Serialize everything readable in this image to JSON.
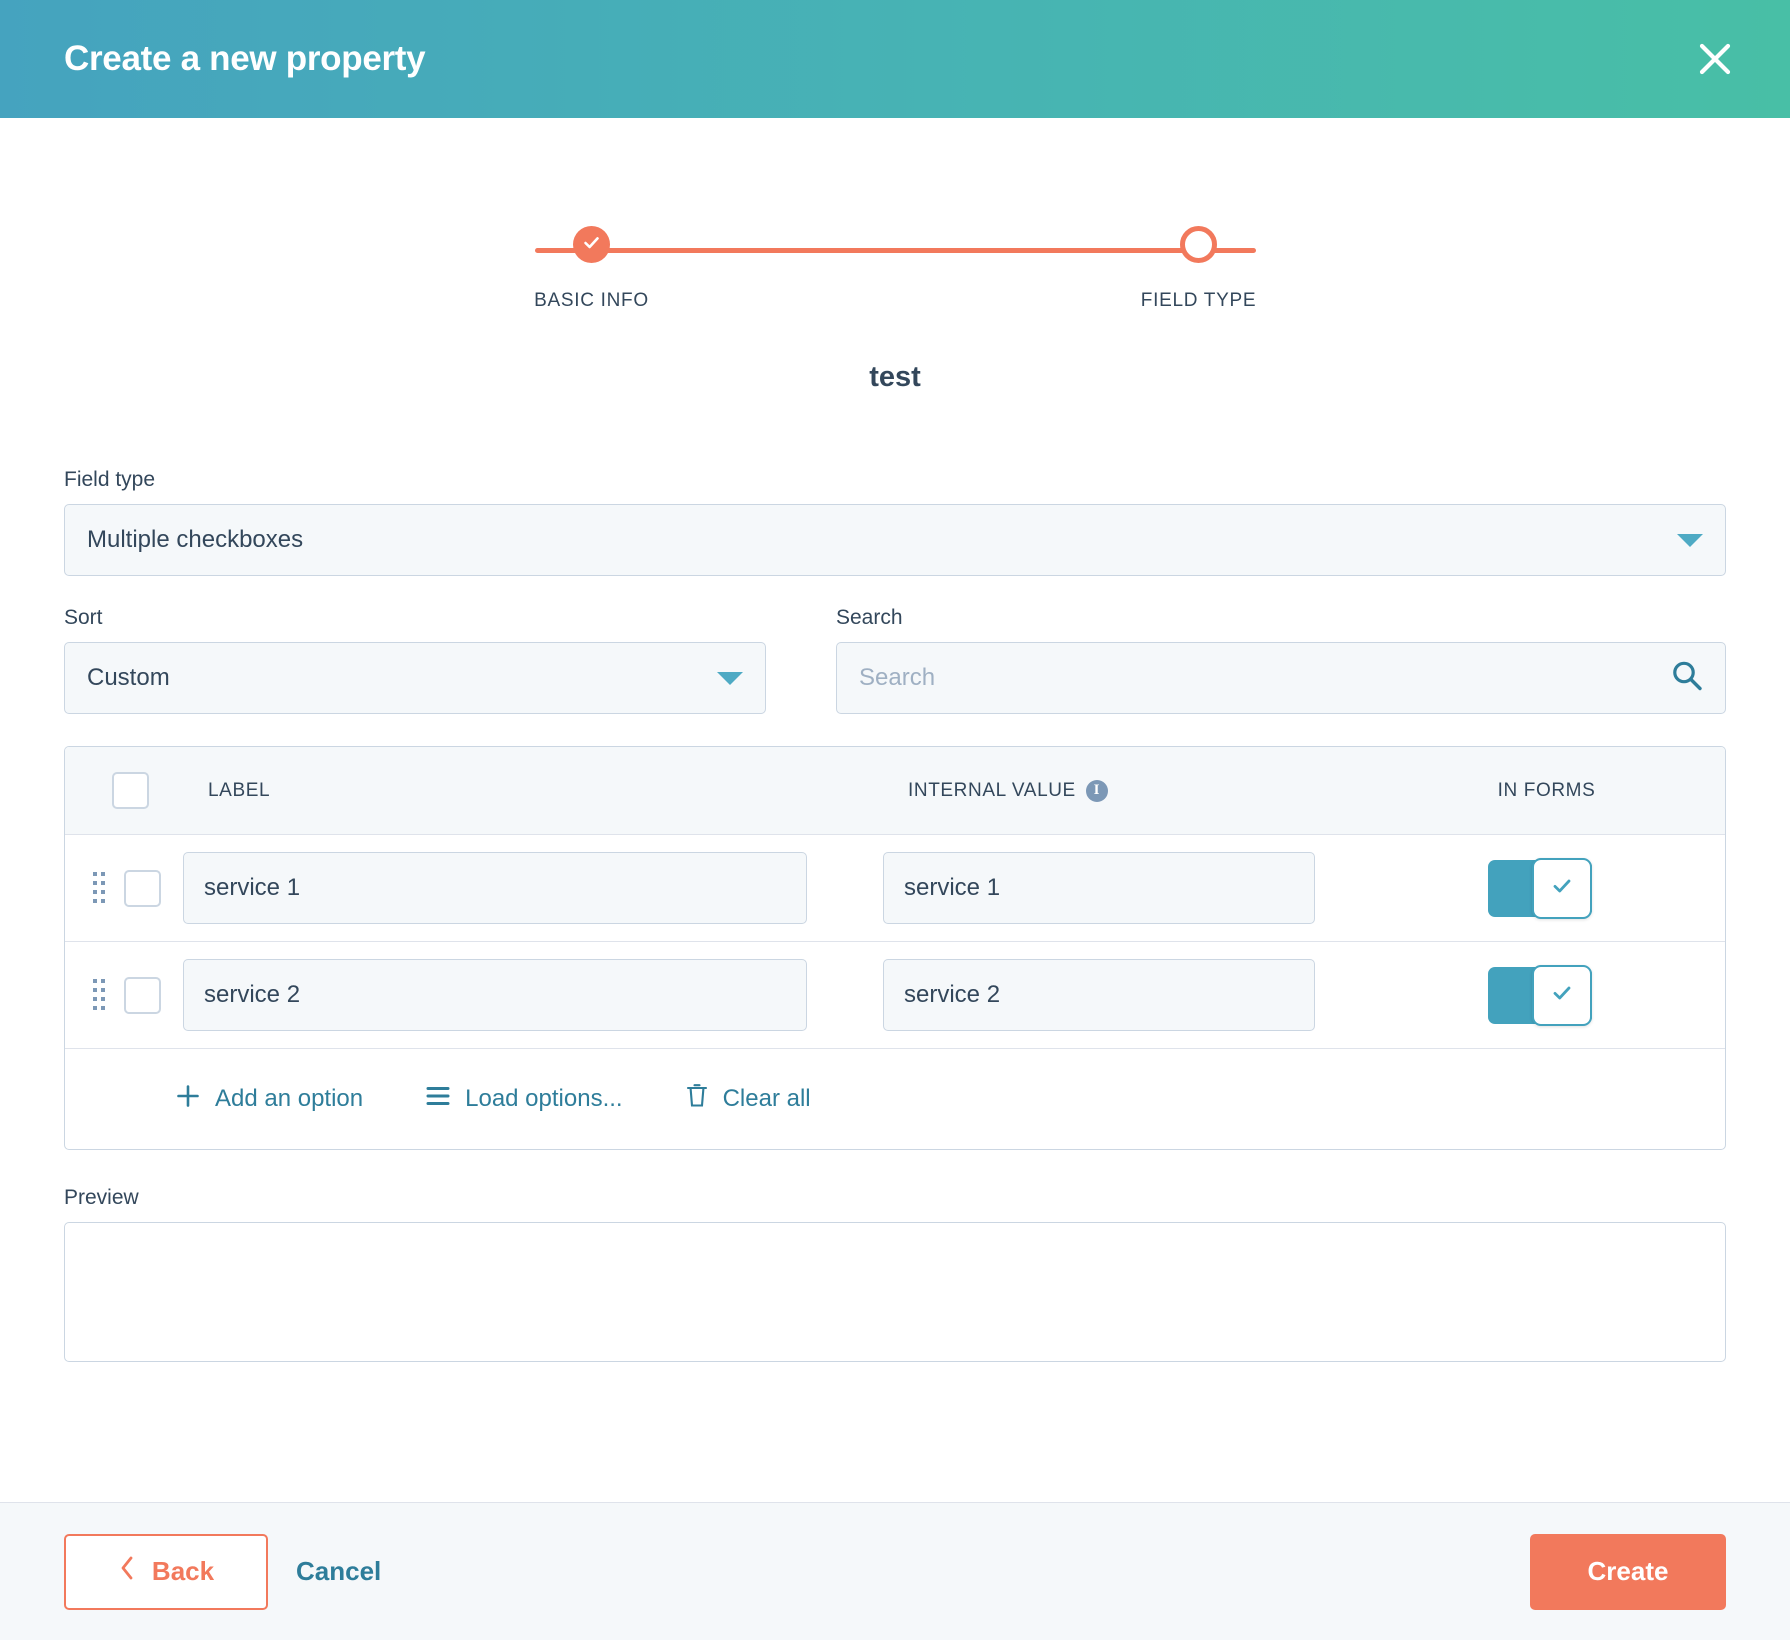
{
  "header": {
    "title": "Create a new property",
    "close_icon": "close-icon"
  },
  "stepper": {
    "steps": [
      {
        "label": "BASIC INFO",
        "state": "done"
      },
      {
        "label": "FIELD TYPE",
        "state": "current"
      }
    ],
    "accent_color": "#f2795c"
  },
  "property_name": "test",
  "field_type": {
    "label": "Field type",
    "value": "Multiple checkboxes",
    "caret_icon": "chevron-down-icon"
  },
  "sort": {
    "label": "Sort",
    "value": "Custom",
    "caret_icon": "chevron-down-icon"
  },
  "search": {
    "label": "Search",
    "value": "",
    "placeholder": "Search",
    "icon": "search-icon"
  },
  "options_table": {
    "columns": {
      "label": "LABEL",
      "internal_value": "INTERNAL VALUE",
      "in_forms": "IN FORMS",
      "info_icon": "info-icon"
    },
    "select_all_checked": false,
    "rows": [
      {
        "label": "service 1",
        "internal_value": "service 1",
        "in_forms": true,
        "checked": false
      },
      {
        "label": "service 2",
        "internal_value": "service 2",
        "in_forms": true,
        "checked": false
      }
    ],
    "actions": [
      {
        "label": "Add an option",
        "icon": "plus-icon"
      },
      {
        "label": "Load options...",
        "icon": "list-icon"
      },
      {
        "label": "Clear all",
        "icon": "trash-icon"
      }
    ]
  },
  "preview": {
    "label": "Preview",
    "content": ""
  },
  "footer": {
    "back_label": "Back",
    "back_icon": "chevron-left-icon",
    "cancel_label": "Cancel",
    "create_label": "Create"
  },
  "colors": {
    "header_gradient_start": "#45a3bf",
    "header_gradient_end": "#48bfa6",
    "accent_orange": "#f2795c",
    "accent_teal": "#43a2bd",
    "link_teal": "#2e7d9a",
    "text": "#33475b",
    "border": "#cbd6e2",
    "field_bg": "#f5f8fa"
  }
}
